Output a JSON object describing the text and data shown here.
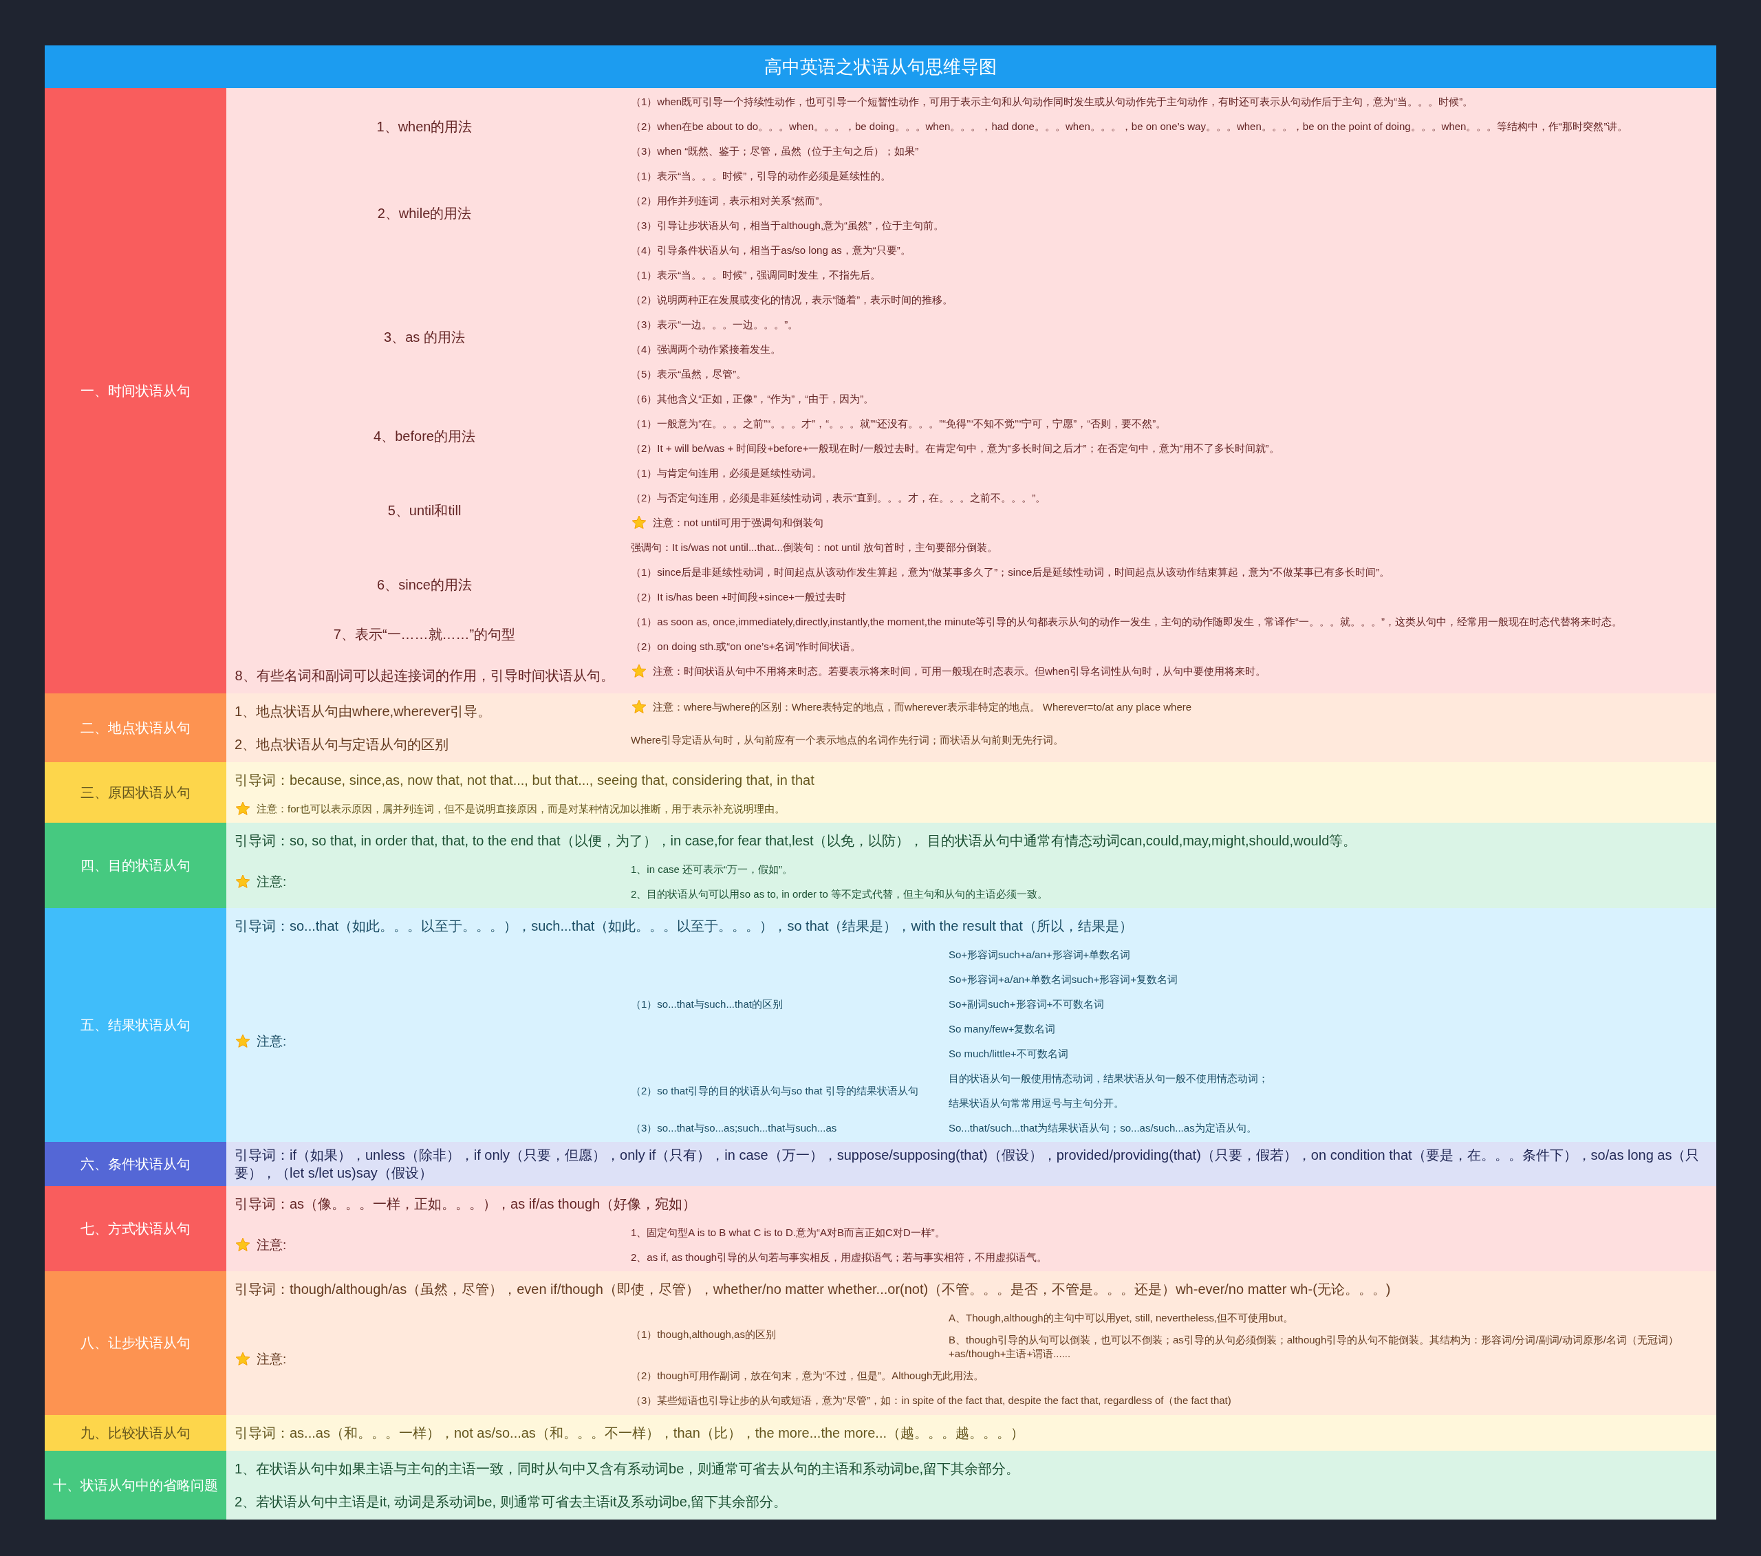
{
  "title": "高中英语之状语从句思维导图",
  "sections": [
    {
      "label": "一、时间状语从句",
      "color": "#f95d5d",
      "items": [
        {
          "kind": "text",
          "text": "1、when的用法",
          "children": [
            {
              "kind": "text",
              "text": "（1）when既可引导一个持续性动作，也可引导一个短暂性动作，可用于表示主句和从句动作同时发生或从句动作先于主句动作，有时还可表示从句动作后于主句，意为“当。。。时候”。"
            },
            {
              "kind": "text",
              "text": "（2）when在be about to do。。。when。。。，be doing。。。when。。。，had done。。。when。。。，be on one’s way。。。when。。。，be on the point of doing。。。when。。。等结构中，作“那时突然”讲。"
            },
            {
              "kind": "text",
              "text": "（3）when “既然、鉴于；尽管，虽然（位于主句之后）；如果”"
            }
          ]
        },
        {
          "kind": "text",
          "text": "2、while的用法",
          "children": [
            {
              "kind": "text",
              "text": "（1）表示“当。。。时候”，引导的动作必须是延续性的。"
            },
            {
              "kind": "text",
              "text": "（2）用作并列连词，表示相对关系“然而”。"
            },
            {
              "kind": "text",
              "text": "（3）引导让步状语从句，相当于although,意为“虽然”，位于主句前。"
            },
            {
              "kind": "text",
              "text": "（4）引导条件状语从句，相当于as/so long as，意为“只要”。"
            }
          ]
        },
        {
          "kind": "text",
          "text": "3、as 的用法",
          "children": [
            {
              "kind": "text",
              "text": "（1）表示“当。。。时候”，强调同时发生，不指先后。"
            },
            {
              "kind": "text",
              "text": "（2）说明两种正在发展或变化的情况，表示“随着”，表示时间的推移。"
            },
            {
              "kind": "text",
              "text": "（3）表示“一边。。。一边。。。”。"
            },
            {
              "kind": "text",
              "text": "（4）强调两个动作紧接着发生。"
            },
            {
              "kind": "text",
              "text": "（5）表示“虽然，尽管”。"
            },
            {
              "kind": "text",
              "text": "（6）其他含义“正如，正像”，“作为”，“由于，因为”。"
            }
          ]
        },
        {
          "kind": "text",
          "text": "4、before的用法",
          "children": [
            {
              "kind": "text",
              "text": "（1）一般意为“在。。。之前”“。。。才”，“。。。就”“还没有。。。”“免得”“不知不觉”“宁可，宁愿”，“否则，要不然”。"
            },
            {
              "kind": "text",
              "text": "（2）It + will be/was + 时间段+before+一般现在时/一般过去时。在肯定句中，意为“多长时间之后才”；在否定句中，意为“用不了多长时间就”。"
            }
          ]
        },
        {
          "kind": "text",
          "text": "5、until和till",
          "children": [
            {
              "kind": "text",
              "text": "（1）与肯定句连用，必须是延续性动词。"
            },
            {
              "kind": "text",
              "text": "（2）与否定句连用，必须是非延续性动词，表示“直到。。。才，在。。。之前不。。。”。"
            },
            {
              "kind": "note",
              "text": "注意：not until可用于强调句和倒装句"
            },
            {
              "kind": "text",
              "text": "强调句：It is/was not until...that...倒装句：not until 放句首时，主句要部分倒装。"
            }
          ]
        },
        {
          "kind": "text",
          "text": "6、since的用法",
          "children": [
            {
              "kind": "text",
              "text": "（1）since后是非延续性动词，时间起点从该动作发生算起，意为“做某事多久了”；since后是延续性动词，时间起点从该动作结束算起，意为“不做某事已有多长时间”。"
            },
            {
              "kind": "text",
              "text": "（2）It is/has been +时间段+since+一般过去时"
            }
          ]
        },
        {
          "kind": "text",
          "text": "7、表示“一……就……”的句型",
          "children": [
            {
              "kind": "text",
              "text": "（1）as soon as, once,immediately,directly,instantly,the moment,the minute等引导的从句都表示从句的动作一发生，主句的动作随即发生，常译作“一。。。就。。。”，这类从句中，经常用一般现在时态代替将来时态。"
            },
            {
              "kind": "text",
              "text": "（2）on doing sth.或“on one’s+名词”作时间状语。"
            }
          ]
        },
        {
          "kind": "text",
          "text": "8、有些名词和副词可以起连接词的作用，引导时间状语从句。",
          "children": [
            {
              "kind": "note",
              "text": "注意：时间状语从句中不用将来时态。若要表示将来时间，可用一般现在时态表示。但when引导名词性从句时，从句中要使用将来时。"
            }
          ]
        }
      ]
    },
    {
      "label": "二、地点状语从句",
      "color": "#fd9351",
      "items": [
        {
          "kind": "text",
          "text": "1、地点状语从句由where,wherever引导。",
          "children": [
            {
              "kind": "note",
              "text": "注意：where与where的区别：Where表特定的地点，而wherever表示非特定的地点。 Wherever=to/at any place where"
            }
          ]
        },
        {
          "kind": "text",
          "text": "2、地点状语从句与定语从句的区别",
          "children": [
            {
              "kind": "text",
              "text": "Where引导定语从句时，从句前应有一个表示地点的名词作先行词；而状语从句前则无先行词。"
            }
          ]
        }
      ]
    },
    {
      "label": "三、原因状语从句",
      "color": "#fdd64b",
      "items": [
        {
          "kind": "text",
          "text": "引导词：because, since,as, now that, not that..., but that..., seeing that, considering that, in that"
        },
        {
          "kind": "note",
          "text": "注意：for也可以表示原因，属并列连词，但不是说明直接原因，而是对某种情况加以推断，用于表示补充说明理由。"
        }
      ]
    },
    {
      "label": "四、目的状语从句",
      "color": "#46c980",
      "items": [
        {
          "kind": "text",
          "text": "引导词：so, so that, in order that, that, to the end that（以便，为了），in case,for fear that,lest（以免，以防）， 目的状语从句中通常有情态动词can,could,may,might,should,would等。"
        },
        {
          "kind": "note",
          "text": "注意:",
          "children": [
            {
              "kind": "text",
              "text": "1、in case 还可表示“万一，假如”。"
            },
            {
              "kind": "text",
              "text": "2、目的状语从句可以用so as to, in order to 等不定式代替，但主句和从句的主语必须一致。"
            }
          ]
        }
      ]
    },
    {
      "label": "五、结果状语从句",
      "color": "#40bdfa",
      "items": [
        {
          "kind": "text",
          "text": "引导词：so...that（如此。。。以至于。。。），such...that（如此。。。以至于。。。），so that（结果是），with the result that（所以，结果是）"
        },
        {
          "kind": "note",
          "text": "注意:",
          "children": [
            {
              "kind": "text",
              "text": "（1）so...that与such...that的区别",
              "children": [
                {
                  "kind": "text",
                  "text": "So+形容词such+a/an+形容词+单数名词"
                },
                {
                  "kind": "text",
                  "text": "So+形容词+a/an+单数名词such+形容词+复数名词"
                },
                {
                  "kind": "text",
                  "text": "So+副词such+形容词+不可数名词"
                },
                {
                  "kind": "text",
                  "text": "So many/few+复数名词"
                },
                {
                  "kind": "text",
                  "text": "So much/little+不可数名词"
                }
              ]
            },
            {
              "kind": "text",
              "text": "（2）so that引导的目的状语从句与so that 引导的结果状语从句",
              "children": [
                {
                  "kind": "text",
                  "text": "目的状语从句一般使用情态动词，结果状语从句一般不使用情态动词；"
                },
                {
                  "kind": "text",
                  "text": "结果状语从句常常用逗号与主句分开。"
                }
              ]
            },
            {
              "kind": "text",
              "text": "（3）so...that与so...as;such...that与such...as",
              "children": [
                {
                  "kind": "text",
                  "text": "So...that/such...that为结果状语从句；so...as/such...as为定语从句。"
                }
              ]
            }
          ]
        }
      ]
    },
    {
      "label": "六、条件状语从句",
      "color": "#5467d6",
      "items": [
        {
          "kind": "text",
          "text": "引导词：if（如果），unless（除非），if only（只要，但愿），only if（只有），in case（万一），suppose/supposing(that)（假设），provided/providing(that)（只要，假若），on condition that（要是，在。。。条件下），so/as long as（只要），（let s/let us)say（假设）"
        }
      ]
    },
    {
      "label": "七、方式状语从句",
      "color": "#f95d5d",
      "items": [
        {
          "kind": "text",
          "text": "引导词：as（像。。。一样，正如。。。），as if/as though（好像，宛如）"
        },
        {
          "kind": "note",
          "text": "注意:",
          "children": [
            {
              "kind": "text",
              "text": "1、固定句型A is to B what C is to D.意为“A对B而言正如C对D一样”。"
            },
            {
              "kind": "text",
              "text": "2、as if, as though引导的从句若与事实相反，用虚拟语气；若与事实相符，不用虚拟语气。"
            }
          ]
        }
      ]
    },
    {
      "label": "八、让步状语从句",
      "color": "#fd9351",
      "items": [
        {
          "kind": "text",
          "text": "引导词：though/although/as（虽然，尽管），even if/though（即使，尽管），whether/no matter whether...or(not)（不管。。。是否，不管是。。。还是）wh-ever/no matter wh-(无论。。。)"
        },
        {
          "kind": "note",
          "text": "注意:",
          "children": [
            {
              "kind": "text",
              "text": "（1）though,although,as的区别",
              "children": [
                {
                  "kind": "text",
                  "text": "A、Though,although的主句中可以用yet, still, nevertheless,但不可使用but。"
                },
                {
                  "kind": "text",
                  "text": "B、though引导的从句可以倒装，也可以不倒装；as引导的从句必须倒装；although引导的从句不能倒装。其结构为：形容词/分词/副词/动词原形/名词（无冠词）+as/though+主语+谓语......"
                }
              ]
            },
            {
              "kind": "text",
              "text": "（2）though可用作副词，放在句末，意为“不过，但是”。Although无此用法。"
            },
            {
              "kind": "text",
              "text": "（3）某些短语也引导让步的从句或短语，意为“尽管”，如：in spite of the fact that, despite the fact that, regardless of（the fact that)"
            }
          ]
        }
      ]
    },
    {
      "label": "九、比较状语从句",
      "color": "#fdd64b",
      "items": [
        {
          "kind": "text",
          "text": "引导词：as...as（和。。。一样），not as/so...as（和。。。不一样），than（比），the more...the more...（越。。。越。。。）"
        }
      ]
    },
    {
      "label": "十、状语从句中的省略问题",
      "color": "#46c980",
      "items": [
        {
          "kind": "text",
          "text": "1、在状语从句中如果主语与主句的主语一致，同时从句中又含有系动词be，则通常可省去从句的主语和系动词be,留下其余部分。"
        },
        {
          "kind": "text",
          "text": "2、若状语从句中主语是it, 动词是系动词be, 则通常可省去主语it及系动词be,留下其余部分。"
        }
      ]
    }
  ]
}
